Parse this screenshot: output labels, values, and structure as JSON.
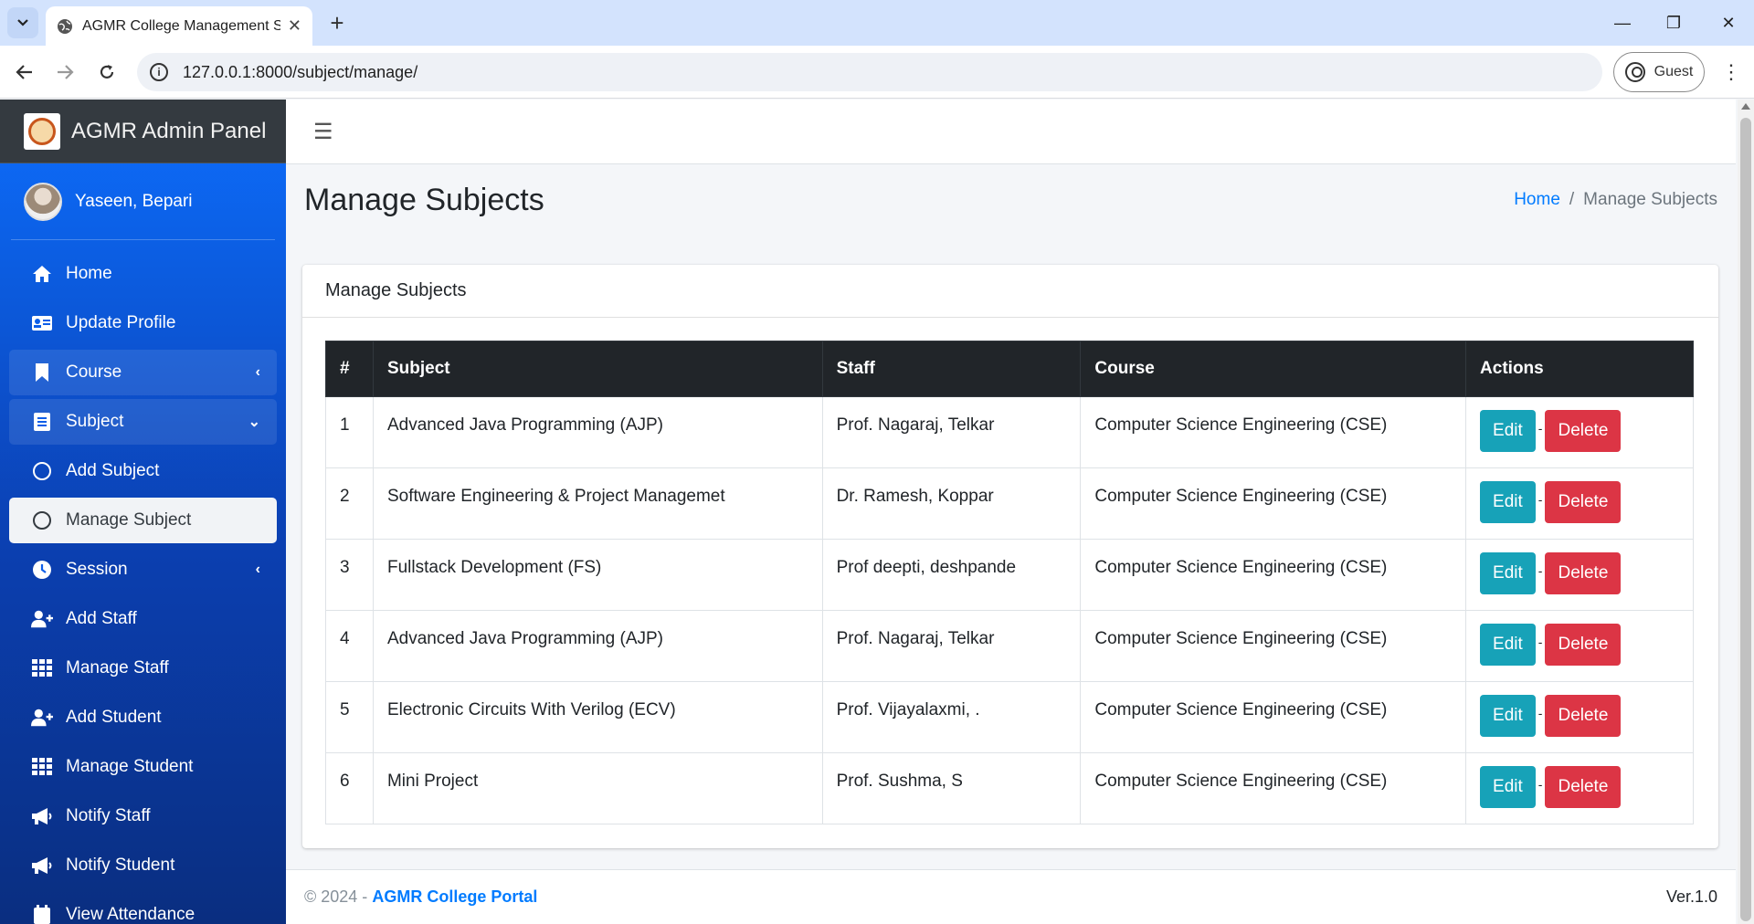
{
  "browser": {
    "tab_title": "AGMR College Management Sy",
    "tab_close": "✕",
    "new_tab": "+",
    "url": "127.0.0.1:8000/subject/manage/",
    "profile": "Guest",
    "controls": {
      "minimize": "—",
      "restore": "❐",
      "close": "✕"
    }
  },
  "app": {
    "brand": "AGMR Admin Panel",
    "user_name": "Yaseen, Bepari",
    "nav": [
      {
        "label": "Home",
        "icon": "home-icon"
      },
      {
        "label": "Update Profile",
        "icon": "id-card-icon"
      },
      {
        "label": "Course",
        "icon": "bookmark-icon",
        "chevron": "left"
      },
      {
        "label": "Subject",
        "icon": "list-icon",
        "chevron": "down"
      },
      {
        "label": "Add Subject",
        "icon": "circle-icon"
      },
      {
        "label": "Manage Subject",
        "icon": "circle-icon",
        "active": true
      },
      {
        "label": "Session",
        "icon": "clock-icon",
        "chevron": "left"
      },
      {
        "label": "Add Staff",
        "icon": "user-plus-icon"
      },
      {
        "label": "Manage Staff",
        "icon": "grid-icon"
      },
      {
        "label": "Add Student",
        "icon": "user-plus-icon"
      },
      {
        "label": "Manage Student",
        "icon": "grid-icon"
      },
      {
        "label": "Notify Staff",
        "icon": "megaphone-icon"
      },
      {
        "label": "Notify Student",
        "icon": "megaphone-icon"
      },
      {
        "label": "View Attendance",
        "icon": "calendar-icon"
      }
    ]
  },
  "page": {
    "title": "Manage Subjects",
    "breadcrumb": {
      "home": "Home",
      "sep": "/",
      "current": "Manage Subjects"
    },
    "card_title": "Manage Subjects",
    "table": {
      "headers": [
        "#",
        "Subject",
        "Staff",
        "Course",
        "Actions"
      ],
      "edit_label": "Edit",
      "delete_label": "Delete",
      "separator": "-",
      "rows": [
        {
          "num": "1",
          "subject": "Advanced Java Programming (AJP)",
          "staff": "Prof. Nagaraj, Telkar",
          "course": "Computer Science Engineering (CSE)"
        },
        {
          "num": "2",
          "subject": "Software Engineering & Project Managemet",
          "staff": "Dr. Ramesh, Koppar",
          "course": "Computer Science Engineering (CSE)"
        },
        {
          "num": "3",
          "subject": "Fullstack Development (FS)",
          "staff": "Prof deepti, deshpande",
          "course": "Computer Science Engineering (CSE)"
        },
        {
          "num": "4",
          "subject": "Advanced Java Programming (AJP)",
          "staff": "Prof. Nagaraj, Telkar",
          "course": "Computer Science Engineering (CSE)"
        },
        {
          "num": "5",
          "subject": "Electronic Circuits With Verilog (ECV)",
          "staff": "Prof. Vijayalaxmi, .",
          "course": "Computer Science Engineering (CSE)"
        },
        {
          "num": "6",
          "subject": "Mini Project",
          "staff": "Prof. Sushma, S",
          "course": "Computer Science Engineering (CSE)"
        }
      ]
    }
  },
  "footer": {
    "copyright": "© 2024 - ",
    "portal": "AGMR College Portal",
    "version": "Ver.1.0"
  },
  "colors": {
    "sidebar_top": "#0d6efd",
    "brand_bg": "#343a40",
    "edit": "#17a2b8",
    "delete": "#dc3545",
    "link": "#007bff",
    "table_head": "#212529"
  }
}
